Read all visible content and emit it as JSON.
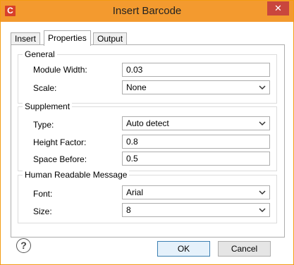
{
  "window": {
    "title": "Insert Barcode",
    "app_icon_letter": "C",
    "close_glyph": "✕",
    "accent_color": "#f39a2f"
  },
  "tabs": [
    {
      "label": "Insert",
      "active": false
    },
    {
      "label": "Properties",
      "active": true
    },
    {
      "label": "Output",
      "active": false
    }
  ],
  "general": {
    "title": "General",
    "module_width_label": "Module Width:",
    "module_width_value": "0.03",
    "scale_label": "Scale:",
    "scale_value": "None"
  },
  "supplement": {
    "title": "Supplement",
    "type_label": "Type:",
    "type_value": "Auto detect",
    "height_factor_label": "Height Factor:",
    "height_factor_value": "0.8",
    "space_before_label": "Space Before:",
    "space_before_value": "0.5"
  },
  "human_readable": {
    "title": "Human Readable Message",
    "font_label": "Font:",
    "font_value": "Arial",
    "size_label": "Size:",
    "size_value": "8"
  },
  "footer": {
    "help_glyph": "?",
    "ok_label": "OK",
    "cancel_label": "Cancel"
  }
}
